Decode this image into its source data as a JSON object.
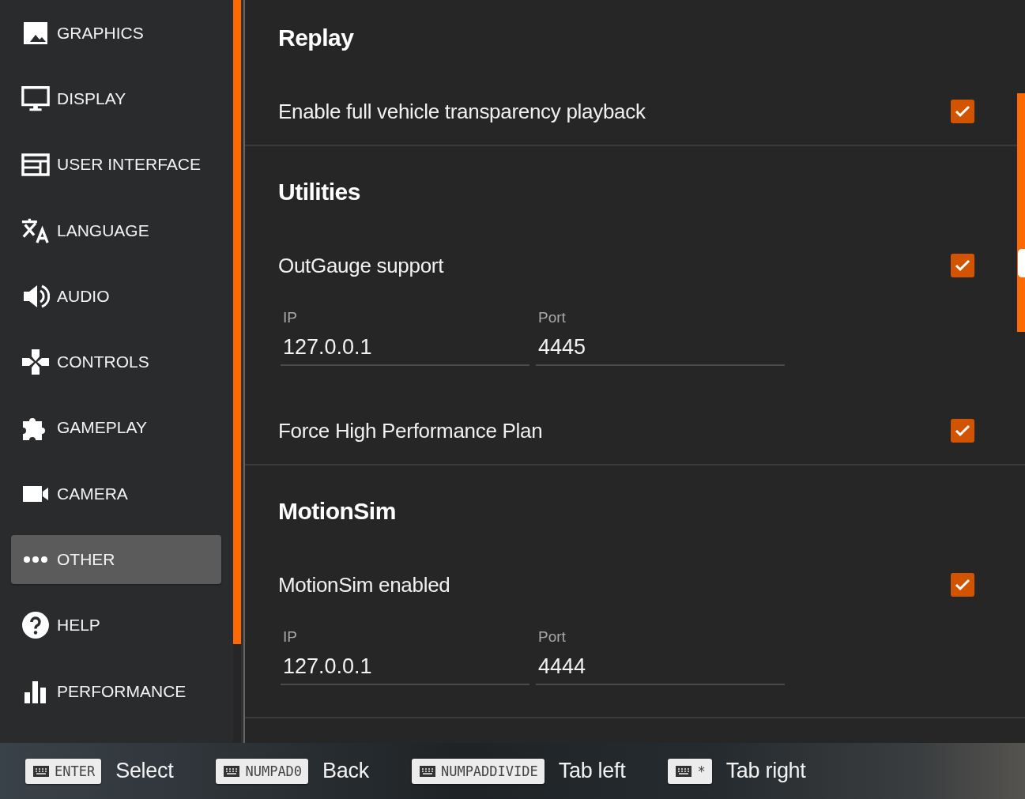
{
  "sidebar": {
    "items": [
      {
        "kind": "graphics",
        "label": "GRAPHICS",
        "selected": false
      },
      {
        "kind": "display",
        "label": "DISPLAY",
        "selected": false
      },
      {
        "kind": "interface",
        "label": "USER INTERFACE",
        "selected": false
      },
      {
        "kind": "language",
        "label": "LANGUAGE",
        "selected": false
      },
      {
        "kind": "audio",
        "label": "AUDIO",
        "selected": false
      },
      {
        "kind": "controls",
        "label": "CONTROLS",
        "selected": false
      },
      {
        "kind": "gameplay",
        "label": "GAMEPLAY",
        "selected": false
      },
      {
        "kind": "camera",
        "label": "CAMERA",
        "selected": false
      },
      {
        "kind": "other",
        "label": "OTHER",
        "selected": true
      },
      {
        "kind": "help",
        "label": "HELP",
        "selected": false
      },
      {
        "kind": "performance",
        "label": "PERFORMANCE",
        "selected": false
      }
    ]
  },
  "sections": [
    {
      "title": "Replay",
      "items": [
        {
          "kind": "checkbox",
          "label": "Enable full vehicle transparency playback",
          "checked": true
        }
      ]
    },
    {
      "title": "Utilities",
      "items": [
        {
          "kind": "checkbox",
          "label": "OutGauge support",
          "checked": true
        },
        {
          "kind": "fields",
          "fields": [
            {
              "label": "IP",
              "value": "127.0.0.1"
            },
            {
              "label": "Port",
              "value": "4445"
            }
          ]
        },
        {
          "kind": "checkbox",
          "label": "Force High Performance Plan",
          "checked": true
        }
      ]
    },
    {
      "title": "MotionSim",
      "items": [
        {
          "kind": "checkbox",
          "label": "MotionSim enabled",
          "checked": true
        },
        {
          "kind": "fields",
          "fields": [
            {
              "label": "IP",
              "value": "127.0.0.1"
            },
            {
              "label": "Port",
              "value": "4444"
            }
          ]
        }
      ]
    }
  ],
  "hints": [
    {
      "key": "ENTER",
      "action": "Select"
    },
    {
      "key": "NUMPAD0",
      "action": "Back"
    },
    {
      "key": "NUMPADDIVIDE",
      "action": "Tab left"
    },
    {
      "key": "*",
      "action": "Tab right"
    }
  ]
}
